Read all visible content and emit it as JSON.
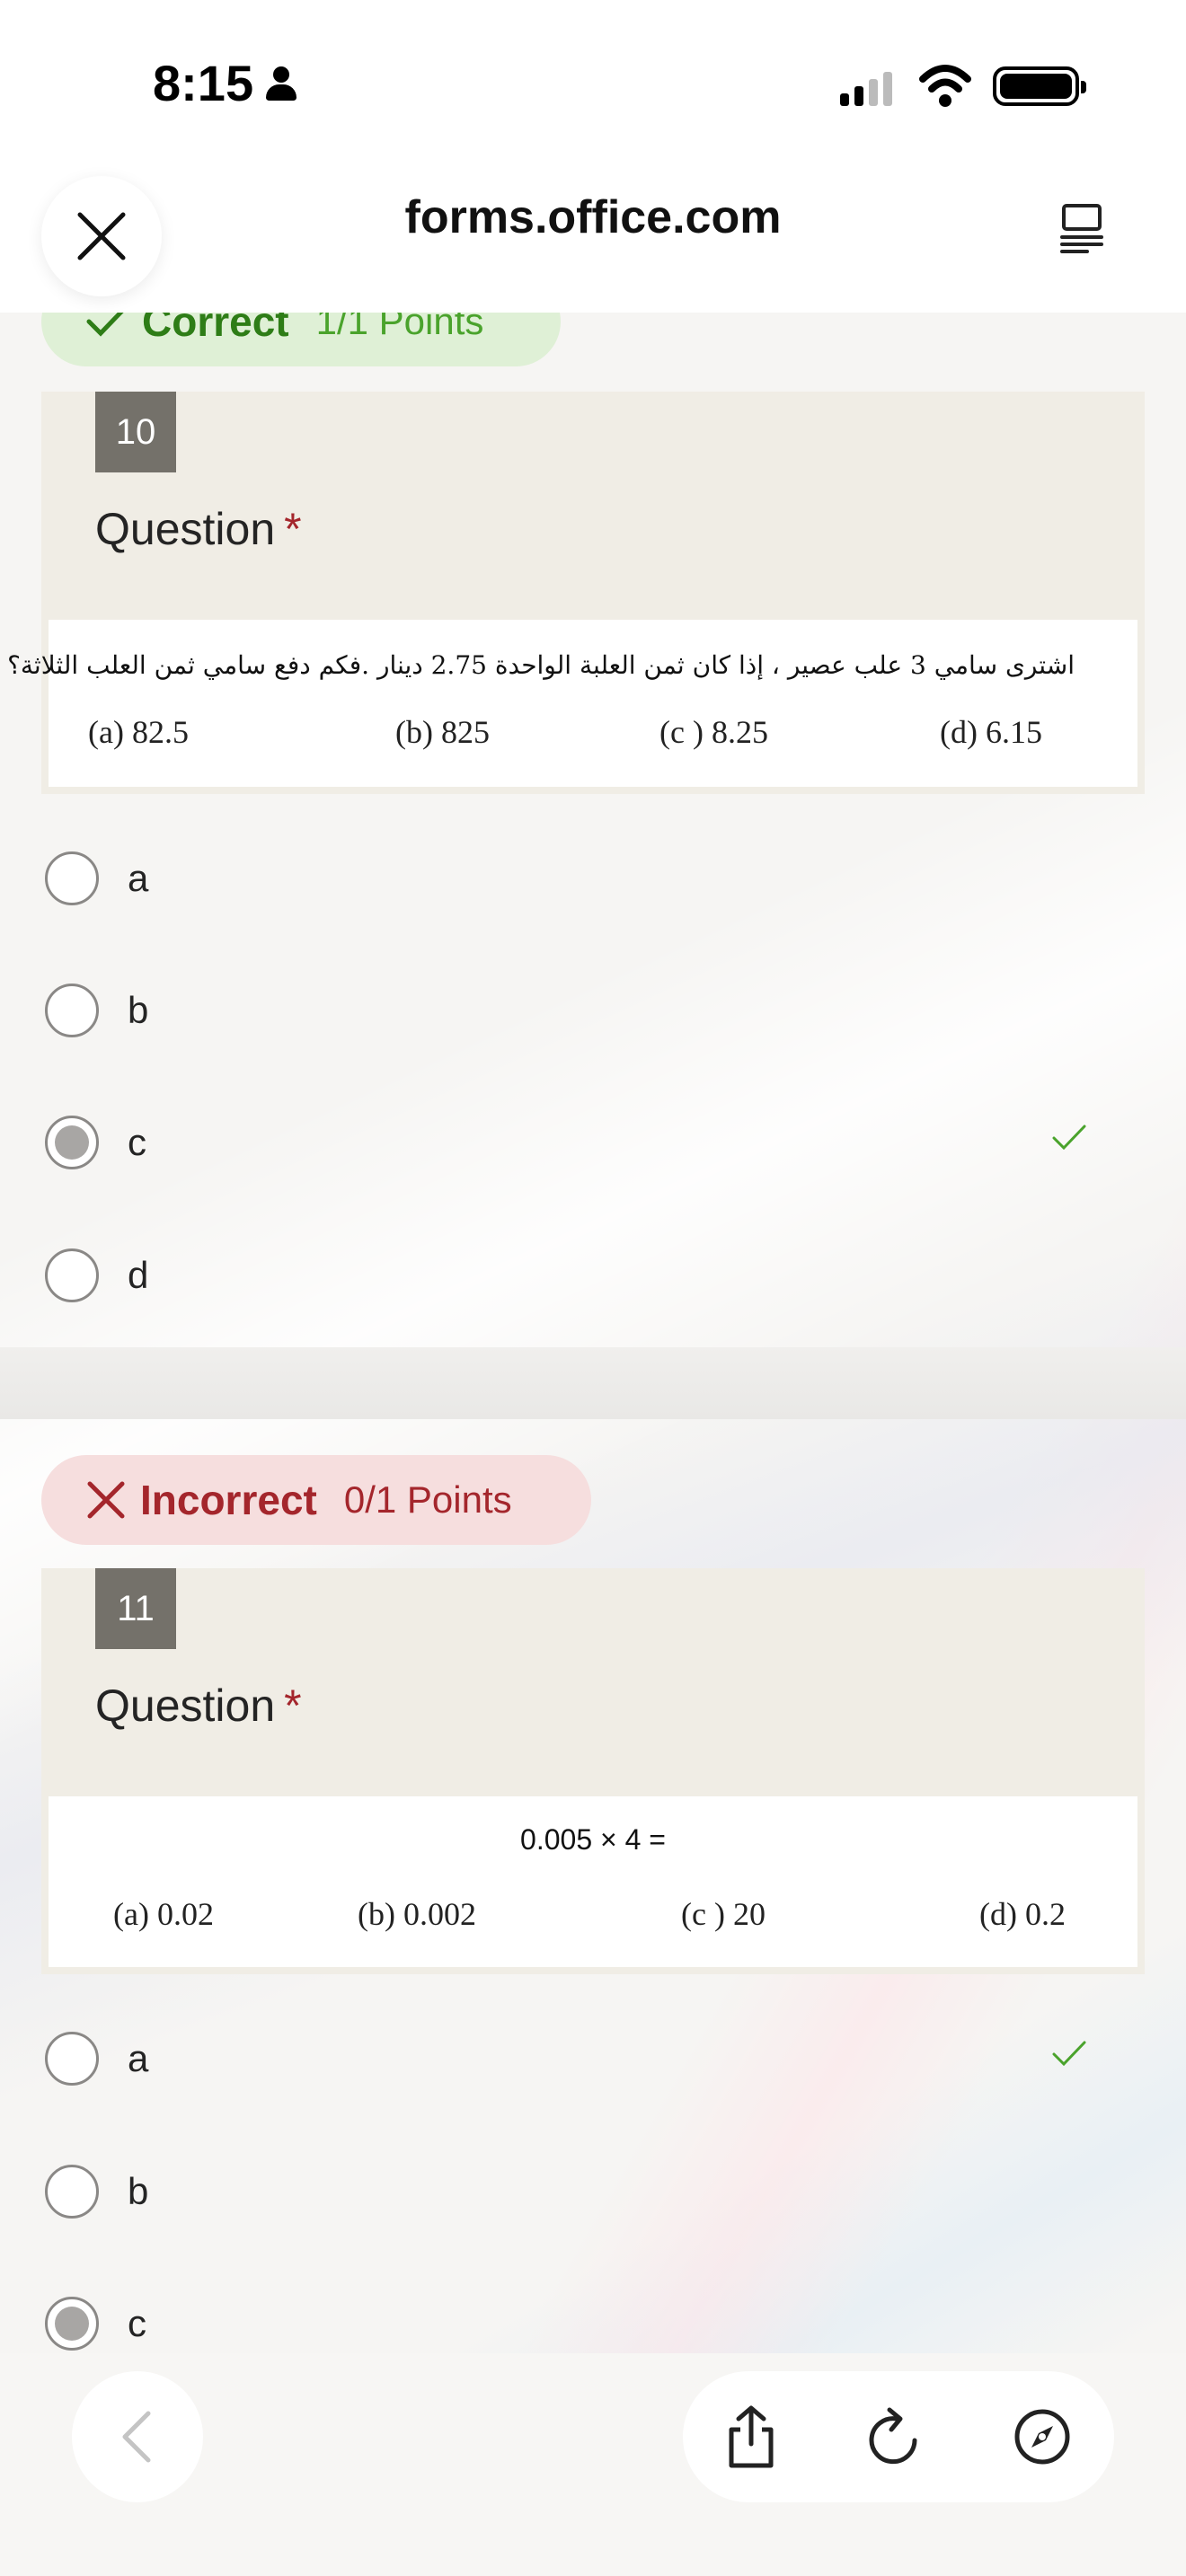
{
  "status_bar": {
    "time": "8:15"
  },
  "browser": {
    "url": "forms.office.com"
  },
  "questions": [
    {
      "result": "Correct",
      "points": "1/1 Points",
      "number": "10",
      "title": "Question",
      "required_mark": "*",
      "image_text": "اشترى سامي 3 علب عصير ، إذا كان ثمن العلبة الواحدة  2.75 دينار .فكم دفع سامي ثمن العلب الثلاثة؟",
      "image_options": [
        "(a) 82.5",
        "(b) 825",
        "(c ) 8.25",
        "(d) 6.15"
      ],
      "answers": [
        {
          "label": "a",
          "selected": false,
          "correct_mark": false
        },
        {
          "label": "b",
          "selected": false,
          "correct_mark": false
        },
        {
          "label": "c",
          "selected": true,
          "correct_mark": true
        },
        {
          "label": "d",
          "selected": false,
          "correct_mark": false
        }
      ]
    },
    {
      "result": "Incorrect",
      "points": "0/1 Points",
      "number": "11",
      "title": "Question",
      "required_mark": "*",
      "image_text": "0.005 × 4 =",
      "image_options": [
        "(a) 0.02",
        "(b) 0.002",
        "(c ) 20",
        "(d) 0.2"
      ],
      "answers": [
        {
          "label": "a",
          "selected": false,
          "correct_mark": true
        },
        {
          "label": "b",
          "selected": false,
          "correct_mark": false
        },
        {
          "label": "c",
          "selected": true,
          "correct_mark": false
        }
      ]
    }
  ],
  "colors": {
    "correct": "#2e7d17",
    "incorrect": "#a4262c",
    "check": "#4aa32c"
  }
}
